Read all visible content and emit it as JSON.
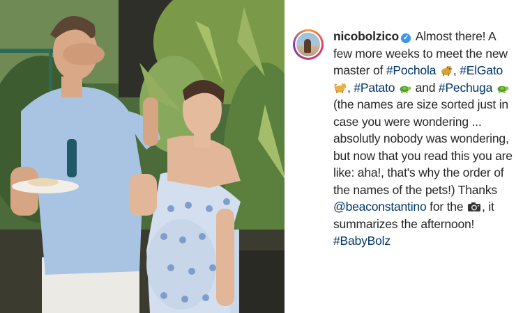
{
  "post": {
    "username": "nicobolzico",
    "caption_intro": "Almost there! A few more weeks to meet the new master of",
    "tag_1": "#Pochola",
    "sep_1": ",",
    "tag_2": "#ElGato",
    "sep_2": ",",
    "tag_3": "#Patato",
    "and_text": "and",
    "tag_4": "#Pechuga",
    "caption_body": "(the names are size sorted just in case you were wondering ... absolutly nobody was wondering, but now that you read this you are like: aha!, that's why the order of the names of the pets!) Thanks",
    "mention": "@beaconstantino",
    "for_the": "for the",
    "caption_end": ", it summarizes the afternoon!",
    "final_tag": "#BabyBolz",
    "verified_mark": "✓",
    "emoji_icons": [
      "dog-emoji",
      "cat-emoji",
      "turtle-emoji",
      "turtle-emoji",
      "camera-emoji"
    ],
    "verified_color": "#3897f0",
    "link_color": "#003569"
  }
}
